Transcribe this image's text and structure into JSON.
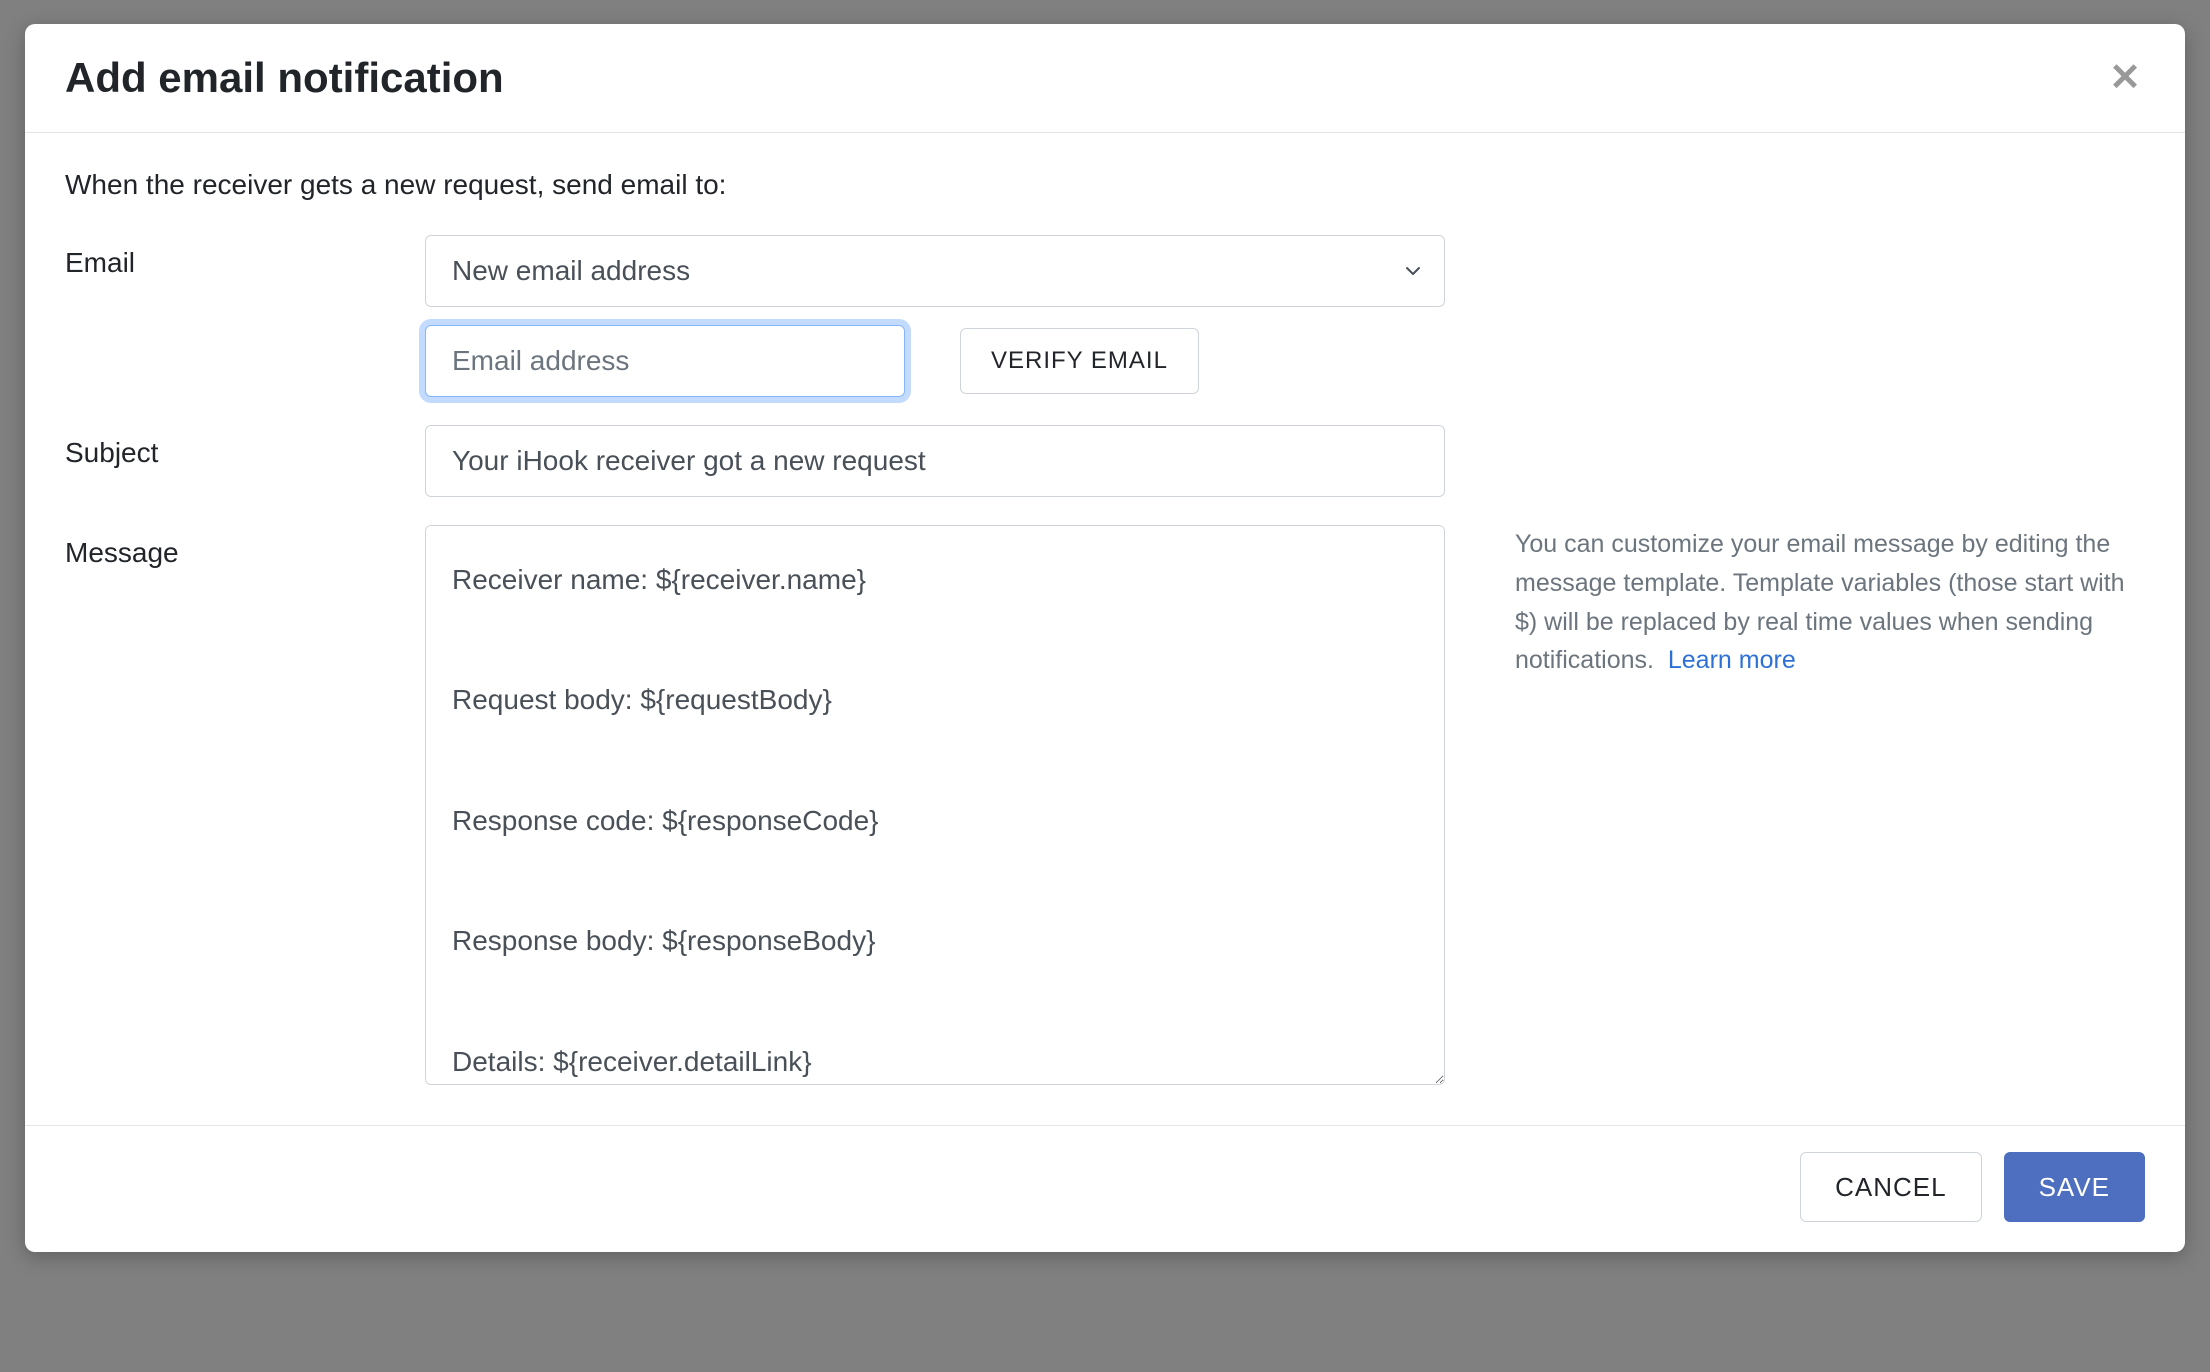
{
  "modal": {
    "title": "Add email notification",
    "intro": "When the receiver gets a new request, send email to:"
  },
  "form": {
    "email": {
      "label": "Email",
      "select_value": "New email address",
      "address_placeholder": "Email address",
      "address_value": "",
      "verify_button": "VERIFY EMAIL"
    },
    "subject": {
      "label": "Subject",
      "value": "Your iHook receiver got a new request"
    },
    "message": {
      "label": "Message",
      "value": "Receiver name: ${receiver.name}\n\nRequest body: ${requestBody}\n\nResponse code: ${responseCode}\n\nResponse body: ${responseBody}\n\nDetails: ${receiver.detailLink}"
    }
  },
  "help": {
    "text": "You can customize your email message by editing the message template. Template variables (those start with $) will be replaced by real time values when sending notifications.",
    "link_label": "Learn more"
  },
  "footer": {
    "cancel": "CANCEL",
    "save": "SAVE"
  }
}
